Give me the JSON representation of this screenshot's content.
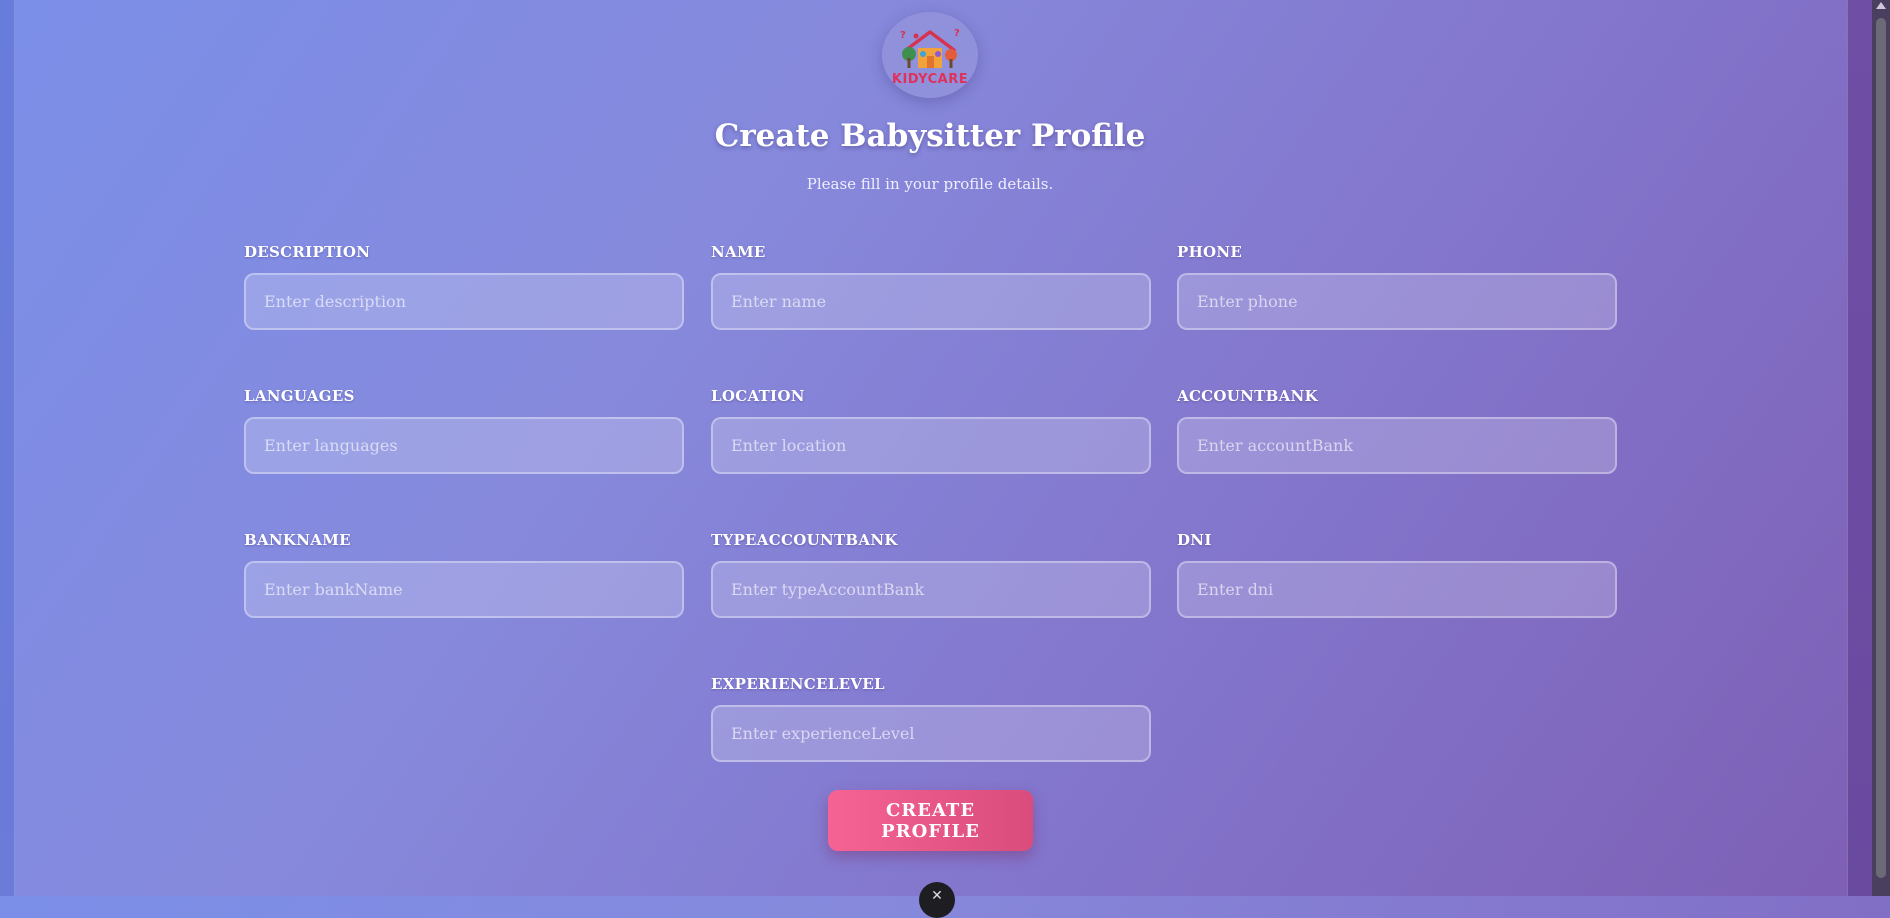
{
  "header": {
    "logo_text": "KIDYCARE",
    "title": "Create Babysitter Profile",
    "subtitle": "Please fill in your profile details."
  },
  "form": {
    "fields": [
      {
        "label": "DESCRIPTION",
        "placeholder": "Enter description",
        "value": ""
      },
      {
        "label": "NAME",
        "placeholder": "Enter name",
        "value": ""
      },
      {
        "label": "PHONE",
        "placeholder": "Enter phone",
        "value": ""
      },
      {
        "label": "LANGUAGES",
        "placeholder": "Enter languages",
        "value": ""
      },
      {
        "label": "LOCATION",
        "placeholder": "Enter location",
        "value": ""
      },
      {
        "label": "ACCOUNTBANK",
        "placeholder": "Enter accountBank",
        "value": ""
      },
      {
        "label": "BANKNAME",
        "placeholder": "Enter bankName",
        "value": ""
      },
      {
        "label": "TYPEACCOUNTBANK",
        "placeholder": "Enter typeAccountBank",
        "value": ""
      },
      {
        "label": "DNI",
        "placeholder": "Enter dni",
        "value": ""
      },
      {
        "label": "EXPERIENCELEVEL",
        "placeholder": "Enter experienceLevel",
        "value": ""
      }
    ],
    "submit_label": "CREATE PROFILE"
  },
  "theme": {
    "accent": "#f56394",
    "logo_red": "#e0315c"
  },
  "icons": {
    "logo": "house-with-trees-logo-icon",
    "fab": "close-icon"
  }
}
